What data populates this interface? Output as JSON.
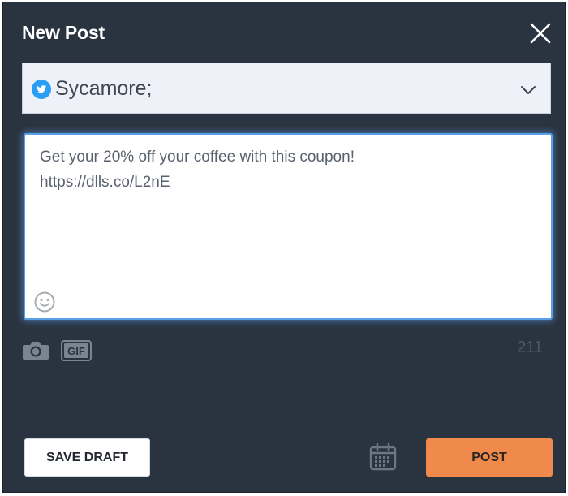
{
  "dialog": {
    "title": "New Post",
    "close_icon": "close-icon"
  },
  "account": {
    "network_icon": "twitter-icon",
    "name": "Sycamore;",
    "dropdown_icon": "chevron-down-icon"
  },
  "composer": {
    "text": "Get your 20% off your coffee with this coupon!\nhttps://dlls.co/L2nE",
    "emoji_icon": "emoji-icon"
  },
  "media": {
    "camera_icon": "camera-icon",
    "gif_label": "GIF"
  },
  "char_count": "211",
  "footer": {
    "save_draft_label": "SAVE DRAFT",
    "schedule_icon": "calendar-icon",
    "post_label": "POST"
  },
  "colors": {
    "dialog_bg": "#2a3340",
    "accent_post": "#ef8a4c",
    "focus_ring": "#5aa0e8",
    "twitter_blue": "#2a9df4"
  }
}
